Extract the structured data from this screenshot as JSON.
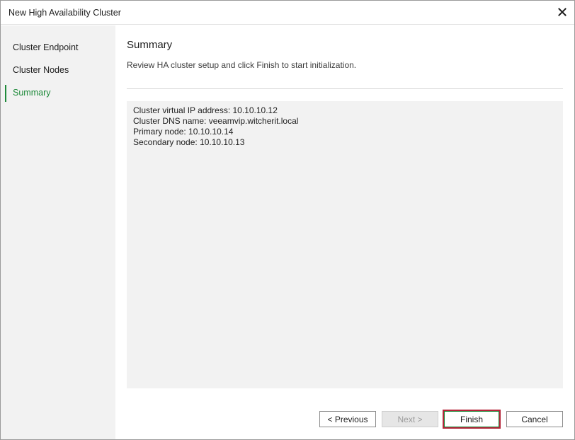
{
  "window": {
    "title": "New High Availability Cluster"
  },
  "sidebar": {
    "steps": [
      {
        "label": "Cluster Endpoint",
        "active": false
      },
      {
        "label": "Cluster Nodes",
        "active": false
      },
      {
        "label": "Summary",
        "active": true
      }
    ]
  },
  "main": {
    "heading": "Summary",
    "subtitle": "Review HA cluster setup and click Finish to start initialization.",
    "summary_lines": [
      "Cluster virtual IP address: 10.10.10.12",
      "Cluster DNS name: veeamvip.witcherit.local",
      "Primary node: 10.10.10.14",
      "Secondary node: 10.10.10.13"
    ]
  },
  "buttons": {
    "previous": "< Previous",
    "next": "Next >",
    "finish": "Finish",
    "cancel": "Cancel"
  },
  "icons": {
    "close": "close-icon"
  },
  "colors": {
    "accent_green": "#1e8a3a",
    "focus_red": "#b5253a",
    "sidebar_bg": "#f2f2f2"
  }
}
